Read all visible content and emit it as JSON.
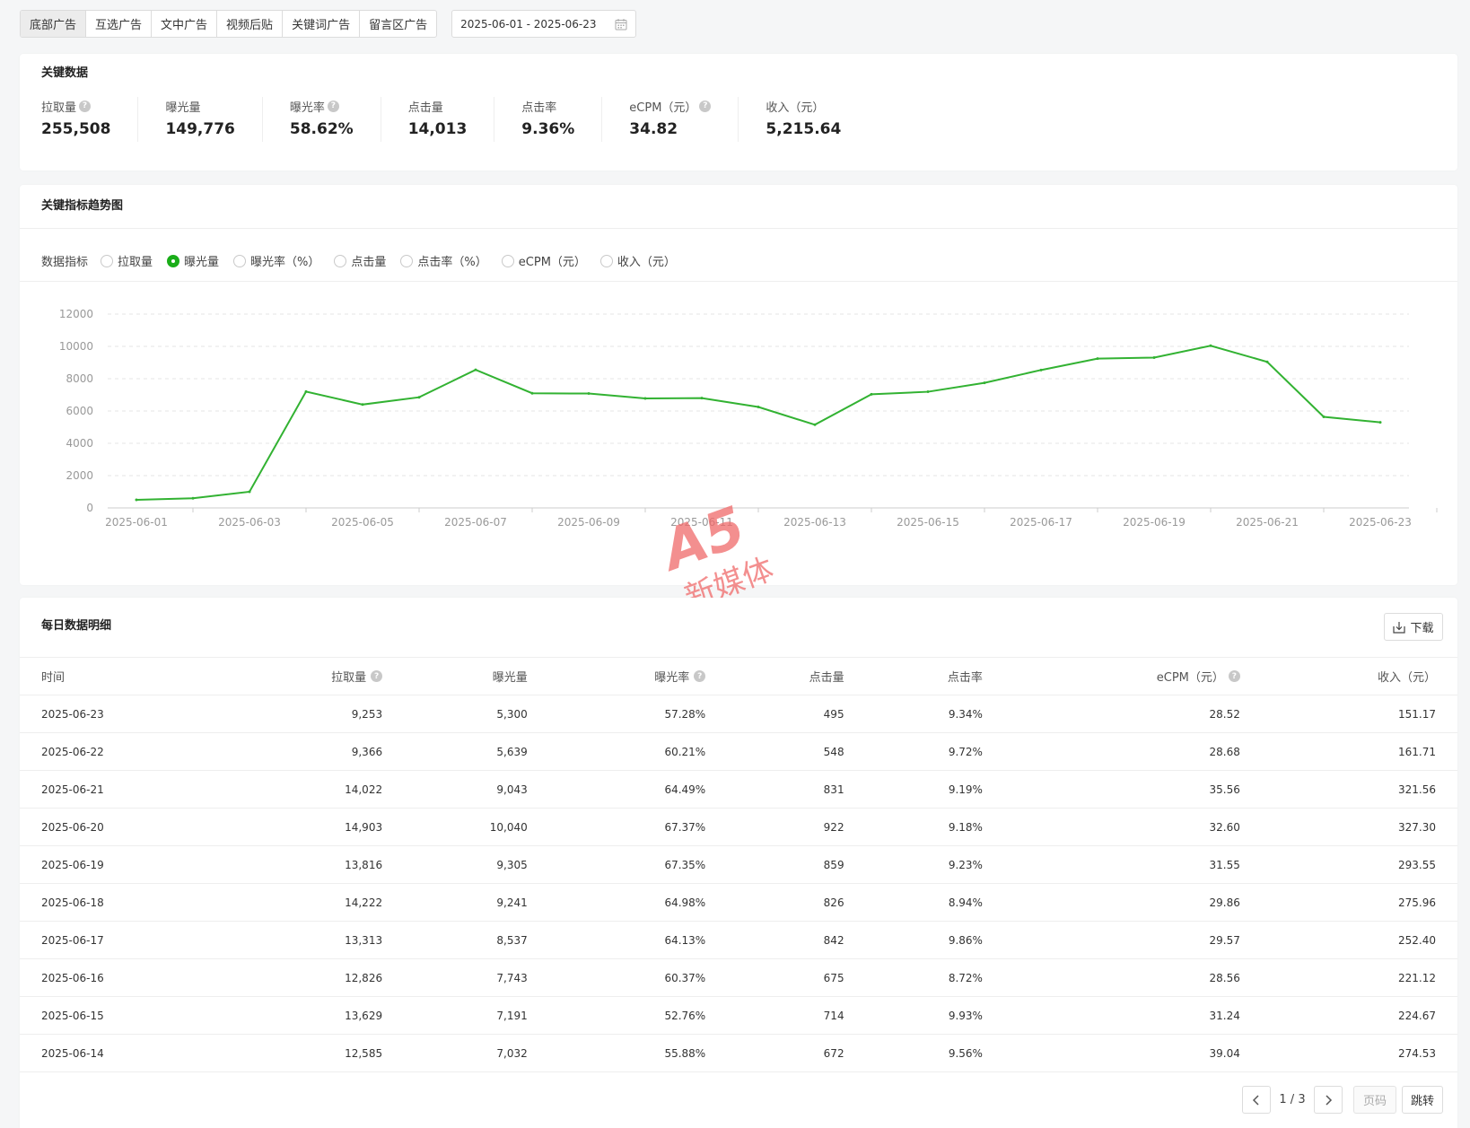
{
  "tabs": [
    {
      "label": "底部广告",
      "active": true
    },
    {
      "label": "互选广告",
      "active": false
    },
    {
      "label": "文中广告",
      "active": false
    },
    {
      "label": "视频后贴",
      "active": false
    },
    {
      "label": "关键词广告",
      "active": false
    },
    {
      "label": "留言区广告",
      "active": false
    }
  ],
  "date_range": "2025-06-01 - 2025-06-23",
  "key_data": {
    "title": "关键数据",
    "metrics": [
      {
        "label": "拉取量",
        "value": "255,508",
        "help": true
      },
      {
        "label": "曝光量",
        "value": "149,776",
        "help": false
      },
      {
        "label": "曝光率",
        "value": "58.62%",
        "help": true
      },
      {
        "label": "点击量",
        "value": "14,013",
        "help": false
      },
      {
        "label": "点击率",
        "value": "9.36%",
        "help": false
      },
      {
        "label": "eCPM（元）",
        "value": "34.82",
        "help": true
      },
      {
        "label": "收入（元）",
        "value": "5,215.64",
        "help": false
      }
    ]
  },
  "trend": {
    "title": "关键指标趋势图",
    "indicator_label": "数据指标",
    "options": [
      {
        "label": "拉取量",
        "checked": false
      },
      {
        "label": "曝光量",
        "checked": true
      },
      {
        "label": "曝光率（%）",
        "checked": false
      },
      {
        "label": "点击量",
        "checked": false
      },
      {
        "label": "点击率（%）",
        "checked": false
      },
      {
        "label": "eCPM（元）",
        "checked": false
      },
      {
        "label": "收入（元）",
        "checked": false
      }
    ]
  },
  "chart_data": {
    "type": "line",
    "x": [
      "2025-06-01",
      "2025-06-02",
      "2025-06-03",
      "2025-06-04",
      "2025-06-05",
      "2025-06-06",
      "2025-06-07",
      "2025-06-08",
      "2025-06-09",
      "2025-06-10",
      "2025-06-11",
      "2025-06-12",
      "2025-06-13",
      "2025-06-14",
      "2025-06-15",
      "2025-06-16",
      "2025-06-17",
      "2025-06-18",
      "2025-06-19",
      "2025-06-20",
      "2025-06-21",
      "2025-06-22",
      "2025-06-23"
    ],
    "x_tick_labels": [
      "2025-06-01",
      "2025-06-03",
      "2025-06-05",
      "2025-06-07",
      "2025-06-09",
      "2025-06-11",
      "2025-06-13",
      "2025-06-15",
      "2025-06-17",
      "2025-06-19",
      "2025-06-21",
      "2025-06-23"
    ],
    "series": [
      {
        "values": [
          500,
          600,
          1000,
          7200,
          6400,
          6850,
          8550,
          7100,
          7080,
          6780,
          6800,
          6250,
          5150,
          7032,
          7191,
          7743,
          8537,
          9241,
          9305,
          10040,
          9043,
          5639,
          5300
        ],
        "color": "#32b232"
      }
    ],
    "ylim": [
      0,
      12000
    ],
    "y_ticks": [
      0,
      2000,
      4000,
      6000,
      8000,
      10000,
      12000
    ],
    "grid": true
  },
  "daily": {
    "title": "每日数据明细",
    "download_label": "下载",
    "columns": [
      {
        "label": "时间",
        "help": false
      },
      {
        "label": "拉取量",
        "help": true
      },
      {
        "label": "曝光量",
        "help": false
      },
      {
        "label": "曝光率",
        "help": true
      },
      {
        "label": "点击量",
        "help": false
      },
      {
        "label": "点击率",
        "help": false
      },
      {
        "label": "eCPM（元）",
        "help": true
      },
      {
        "label": "收入（元）",
        "help": false
      }
    ],
    "rows": [
      [
        "2025-06-23",
        "9,253",
        "5,300",
        "57.28%",
        "495",
        "9.34%",
        "28.52",
        "151.17"
      ],
      [
        "2025-06-22",
        "9,366",
        "5,639",
        "60.21%",
        "548",
        "9.72%",
        "28.68",
        "161.71"
      ],
      [
        "2025-06-21",
        "14,022",
        "9,043",
        "64.49%",
        "831",
        "9.19%",
        "35.56",
        "321.56"
      ],
      [
        "2025-06-20",
        "14,903",
        "10,040",
        "67.37%",
        "922",
        "9.18%",
        "32.60",
        "327.30"
      ],
      [
        "2025-06-19",
        "13,816",
        "9,305",
        "67.35%",
        "859",
        "9.23%",
        "31.55",
        "293.55"
      ],
      [
        "2025-06-18",
        "14,222",
        "9,241",
        "64.98%",
        "826",
        "8.94%",
        "29.86",
        "275.96"
      ],
      [
        "2025-06-17",
        "13,313",
        "8,537",
        "64.13%",
        "842",
        "9.86%",
        "29.57",
        "252.40"
      ],
      [
        "2025-06-16",
        "12,826",
        "7,743",
        "60.37%",
        "675",
        "8.72%",
        "28.56",
        "221.12"
      ],
      [
        "2025-06-15",
        "13,629",
        "7,191",
        "52.76%",
        "714",
        "9.93%",
        "31.24",
        "224.67"
      ],
      [
        "2025-06-14",
        "12,585",
        "7,032",
        "55.88%",
        "672",
        "9.56%",
        "39.04",
        "274.53"
      ]
    ]
  },
  "pagination": {
    "info": "1 / 3",
    "page_placeholder": "页码",
    "jump_label": "跳转"
  },
  "watermark": {
    "brand": "A5",
    "text": "新媒体",
    "color": "#f06a6a"
  }
}
